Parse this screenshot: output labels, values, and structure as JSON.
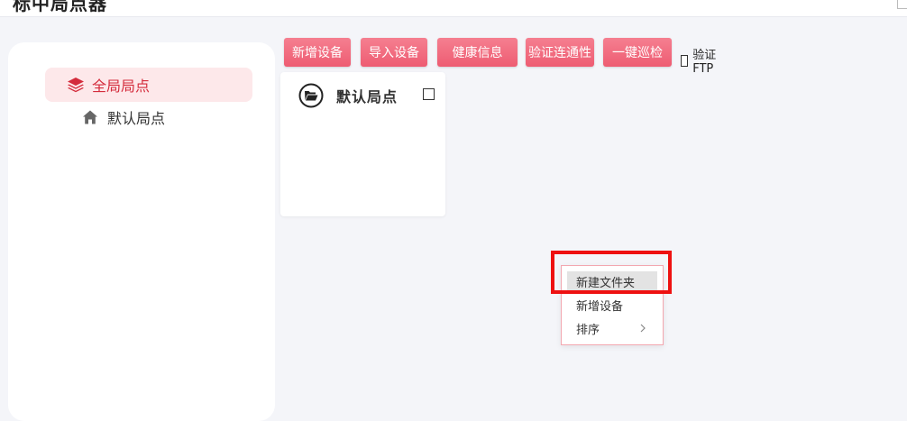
{
  "app": {
    "title": "标中局点器"
  },
  "sidebar": {
    "items": [
      {
        "label": "全局局点",
        "icon": "layers-icon"
      },
      {
        "label": "默认局点",
        "icon": "home-icon"
      }
    ]
  },
  "toolbar": {
    "buttons": [
      {
        "label": "新增设备"
      },
      {
        "label": "导入设备"
      },
      {
        "label": "健康信息"
      },
      {
        "label": "验证连通性"
      },
      {
        "label": "一键巡检"
      }
    ],
    "ftp_label": "验证FTP"
  },
  "cards": [
    {
      "title": "默认局点",
      "icon": "folder-open-icon"
    }
  ],
  "context_menu": {
    "items": [
      {
        "label": "新建文件夹"
      },
      {
        "label": "新增设备"
      },
      {
        "label": "排序",
        "icon": "chevron-right-icon"
      }
    ]
  },
  "colors": {
    "accent": "#ee5c72",
    "accent_light": "#f57f90",
    "active_bg": "#fde8ea",
    "active_text": "#d42c3c",
    "highlight_border": "#ee1111"
  }
}
